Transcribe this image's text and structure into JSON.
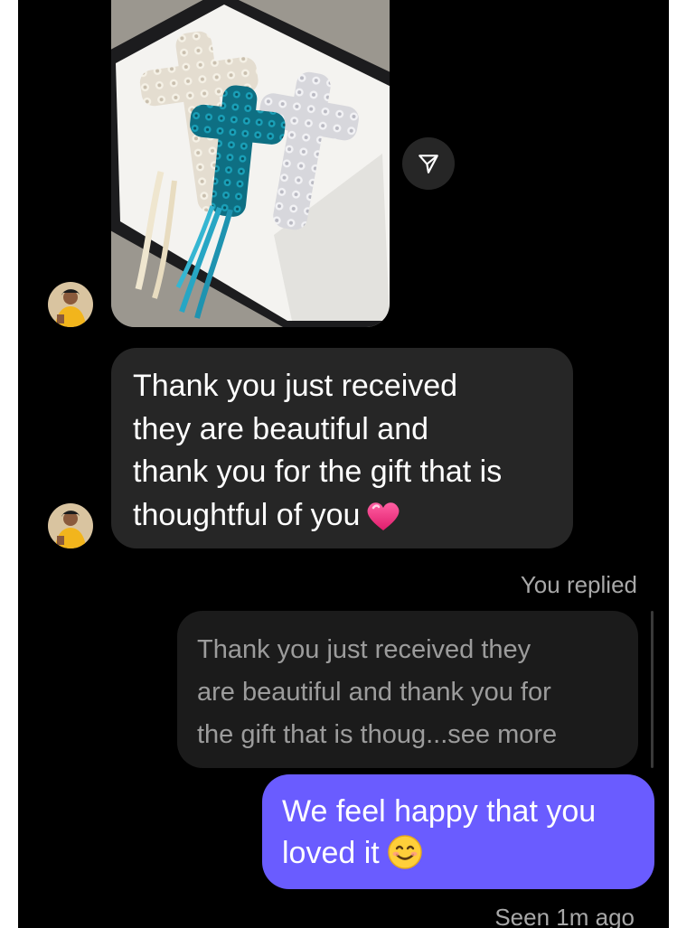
{
  "thread": {
    "received_message": {
      "lines": [
        "Thank you just received",
        "they are beautiful and",
        "thank you for the gift that is",
        "thoughtful of you"
      ],
      "emoji": "heart-icon"
    },
    "replied_label": "You replied",
    "reply_quote": {
      "lines": [
        "Thank you just received they",
        "are beautiful and thank you for",
        "the gift that is thoug...see more"
      ]
    },
    "sent_message": {
      "lines": [
        "We feel happy that you",
        "loved it"
      ],
      "emoji": "smiling-face-icon"
    },
    "status": "Seen 1m ago"
  },
  "colors": {
    "background": "#000000",
    "incoming_bubble": "#262626",
    "outgoing_bubble": "#6a5cff",
    "muted_text": "#a8a8a8",
    "heart": "#ff3d8b"
  }
}
